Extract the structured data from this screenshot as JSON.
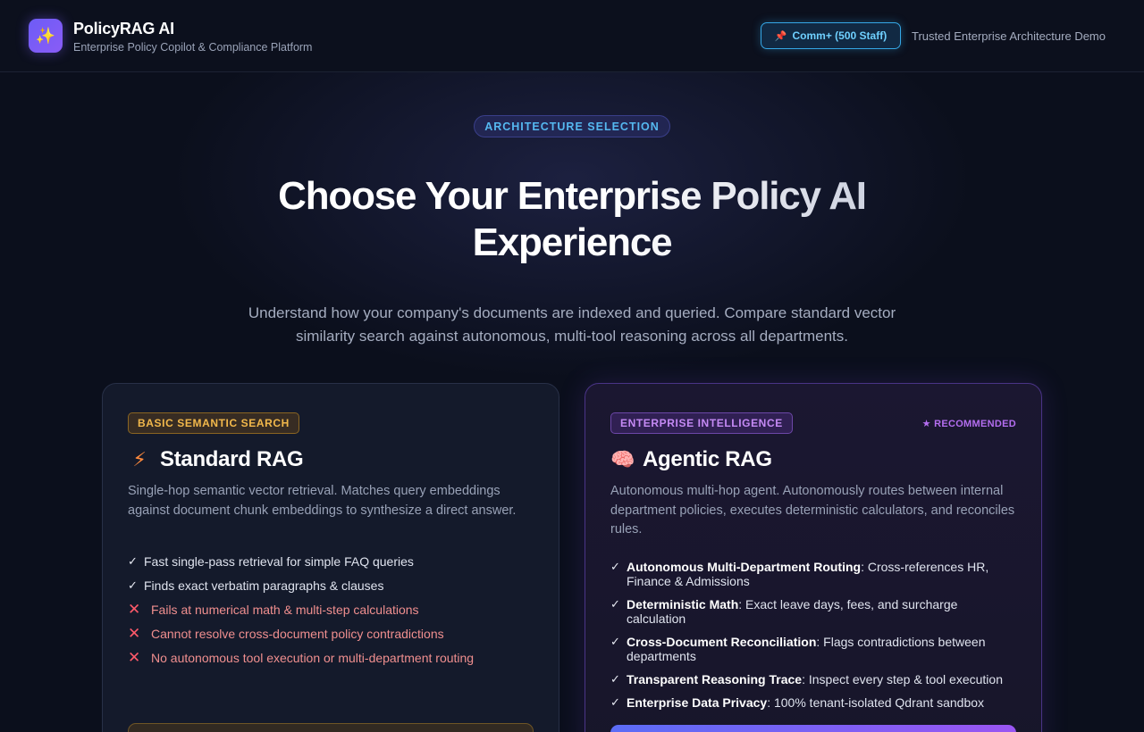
{
  "header": {
    "logo_icon": "sparkles-icon",
    "logo_glyph": "✨",
    "title": "PolicyRAG AI",
    "subtitle": "Enterprise Policy Copilot & Compliance Platform",
    "plan_icon": "pushpin-icon",
    "plan_glyph": "📌",
    "plan_label": "Comm+ (500 Staff)",
    "trusted": "Trusted Enterprise Architecture Demo"
  },
  "hero": {
    "eyebrow": "ARCHITECTURE SELECTION",
    "title_line1": "Choose Your Enterprise Policy AI",
    "title_line2": "Experience",
    "subtitle": "Understand how your company's documents are indexed and queried. Compare standard vector similarity search against autonomous, multi-tool reasoning across all departments."
  },
  "cards": {
    "standard": {
      "badge": "BASIC SEMANTIC SEARCH",
      "icon": "lightning-bolt-icon",
      "glyph": "⚡",
      "title": "Standard RAG",
      "description": "Single-hop semantic vector retrieval. Matches query embeddings against document chunk embeddings to synthesize a direct answer.",
      "features": [
        {
          "mark": "✓",
          "text": "Fast single-pass retrieval for simple FAQ queries"
        },
        {
          "mark": "✓",
          "text": "Finds exact verbatim paragraphs & clauses"
        },
        {
          "mark": "✕",
          "text": "Fails at numerical math & multi-step calculations"
        },
        {
          "mark": "✕",
          "text": "Cannot resolve cross-document policy contradictions"
        },
        {
          "mark": "✕",
          "text": "No autonomous tool execution or multi-department routing"
        }
      ]
    },
    "agentic": {
      "badge": "ENTERPRISE INTELLIGENCE",
      "recommended": "★ RECOMMENDED",
      "icon": "brain-icon",
      "glyph": "🧠",
      "title": "Agentic RAG",
      "description": "Autonomous multi-hop agent. Autonomously routes between internal department policies, executes deterministic calculators, and reconciles rules.",
      "features": [
        {
          "mark": "✓",
          "bold": "Autonomous Multi-Department Routing",
          "text": ": Cross-references HR, Finance & Admissions"
        },
        {
          "mark": "✓",
          "bold": "Deterministic Math",
          "text": ": Exact leave days, fees, and surcharge calculation"
        },
        {
          "mark": "✓",
          "bold": "Cross-Document Reconciliation",
          "text": ": Flags contradictions between departments"
        },
        {
          "mark": "✓",
          "bold": "Transparent Reasoning Trace",
          "text": ": Inspect every step & tool execution"
        },
        {
          "mark": "✓",
          "bold": "Enterprise Data Privacy",
          "text": ": 100% tenant-isolated Qdrant sandbox"
        }
      ]
    }
  }
}
